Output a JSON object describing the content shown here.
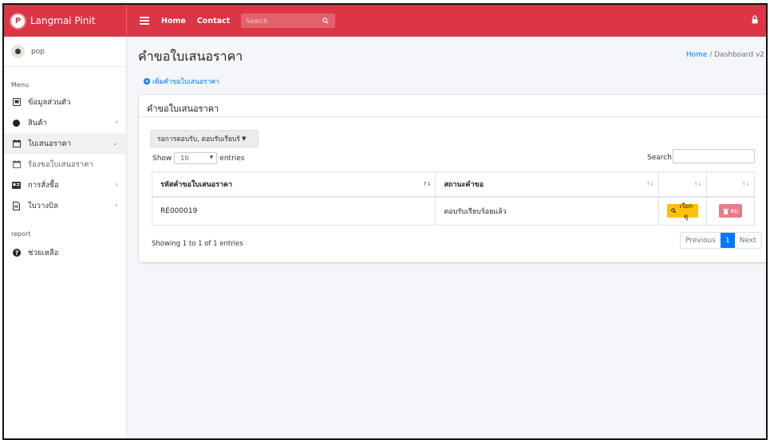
{
  "brand": {
    "logo_letter": "P",
    "name": "Langmai Pinit"
  },
  "topnav": {
    "links": [
      "Home",
      "Contact"
    ],
    "search_placeholder": "Search",
    "icons": [
      "hamburger-icon",
      "search-icon",
      "lock-icon"
    ]
  },
  "user": {
    "name": "pop"
  },
  "sidebar": {
    "menu_header": "Menu",
    "items": [
      {
        "label": "ข้อมูลส่วนตัว",
        "icon": "id-card-icon",
        "chevron": ""
      },
      {
        "label": "สินค้า",
        "icon": "circle-icon",
        "chevron": "‹"
      },
      {
        "label": "ใบเสนอราคา",
        "icon": "calendar-icon",
        "chevron": "⌄"
      },
      {
        "label": "ร้องขอใบเสนอราคา",
        "icon": "calendar-icon",
        "chevron": ""
      },
      {
        "label": "การสั่งซื้อ",
        "icon": "cart-card-icon",
        "chevron": "‹"
      },
      {
        "label": "ใบวางบิล",
        "icon": "document-icon",
        "chevron": "‹"
      }
    ],
    "report_header": "report",
    "help_label": "ช่วยเหลือ"
  },
  "page": {
    "title": "คำขอใบเสนอราคา",
    "breadcrumb_home": "Home",
    "breadcrumb_sep": "/",
    "breadcrumb_current": "Dashboard v2",
    "add_link": "เพิ่มคำขอใบเสนอราคา"
  },
  "card": {
    "title": "คำขอใบเสนอราคา",
    "filter_label": "รอการตอบรับ, ตอบรับเรียบร้",
    "show_label": "Show",
    "page_size": "10",
    "entries_label": "entries",
    "search_label": "Search:",
    "table": {
      "columns": [
        "รหัสคำขอใบเสนอราคา",
        "สถานะคำขอ",
        "",
        ""
      ],
      "rows": [
        {
          "code": "RE000019",
          "status": "ตอบรับเรียบร้อยแล้ว",
          "view_label": "เรียกดู",
          "delete_label": "ลบ"
        }
      ]
    },
    "info": "Showing 1 to 1 of 1 entries",
    "pagination": {
      "previous": "Previous",
      "current": "1",
      "next": "Next"
    }
  },
  "colors": {
    "topbar": "#dc3545",
    "primary": "#007bff",
    "view_button": "#ffc107",
    "delete_button": "#e77b87"
  }
}
